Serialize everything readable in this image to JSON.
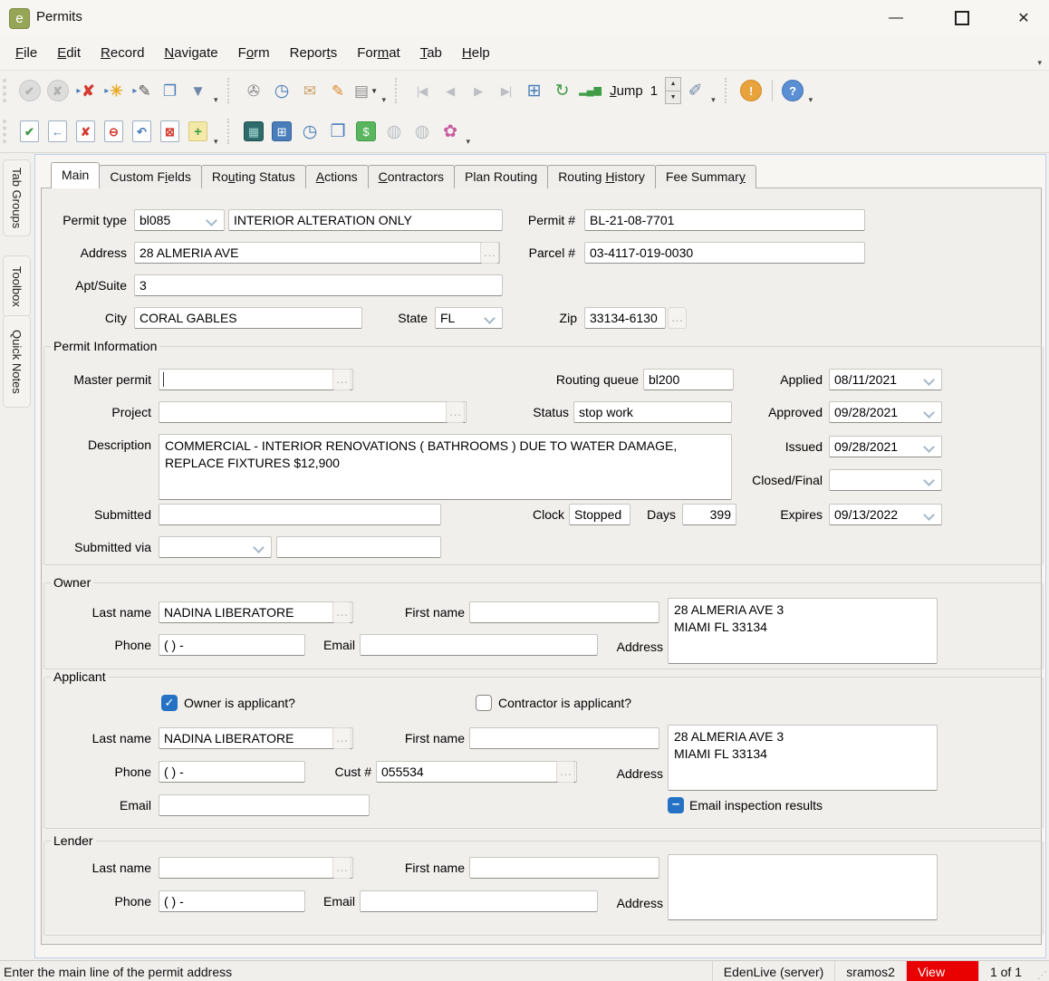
{
  "window": {
    "title": "Permits",
    "app_icon_letter": "e"
  },
  "menu": {
    "items": [
      {
        "label": "File",
        "accel": 0
      },
      {
        "label": "Edit",
        "accel": 0
      },
      {
        "label": "Record",
        "accel": 0
      },
      {
        "label": "Navigate",
        "accel": 0
      },
      {
        "label": "Form",
        "accel": 1
      },
      {
        "label": "Reports",
        "accel": 5
      },
      {
        "label": "Format",
        "accel": 3
      },
      {
        "label": "Tab",
        "accel": 0
      },
      {
        "label": "Help",
        "accel": 0
      }
    ]
  },
  "toolbar1": {
    "items": [
      {
        "name": "accept-record",
        "icon": "accept-record-icon",
        "glyph": "✔",
        "cls": "i-circle c-disabled",
        "disabled": true
      },
      {
        "name": "cancel-record",
        "icon": "cancel-record-icon",
        "glyph": "✘",
        "cls": "i-circle c-disabled",
        "disabled": true
      },
      {
        "name": "delete-record",
        "icon": "delete-record-icon",
        "glyph": "✘",
        "cls": "g-red",
        "pre": "▸"
      },
      {
        "name": "new-record",
        "icon": "new-record-icon",
        "glyph": "✳",
        "cls": "g-gold",
        "pre": "▸"
      },
      {
        "name": "edit-record",
        "icon": "edit-record-icon",
        "glyph": "✎",
        "cls": "g-ink",
        "pre": "▸"
      },
      {
        "name": "copy-record",
        "icon": "copy-record-icon",
        "glyph": "❐",
        "cls": "g-blue"
      },
      {
        "name": "filter",
        "icon": "filter-funnel-icon",
        "glyph": "▼",
        "cls": "g-steel"
      },
      {
        "type": "overflow",
        "name": "toolbar1-group1-overflow"
      },
      {
        "sep": true
      },
      {
        "name": "attachments",
        "icon": "paperclip-icon",
        "glyph": "✇",
        "cls": "g-gray"
      },
      {
        "name": "history",
        "icon": "clock-arrow-icon",
        "glyph": "◷",
        "cls": "g-blue big"
      },
      {
        "name": "send-email",
        "icon": "envelope-icon",
        "glyph": "✉",
        "cls": "g-tan"
      },
      {
        "name": "edit-tag",
        "icon": "tag-pencil-icon",
        "glyph": "✎",
        "cls": "g-orange"
      },
      {
        "name": "print",
        "icon": "printer-icon",
        "glyph": "▤",
        "cls": "g-gray",
        "dd": true
      },
      {
        "type": "overflow",
        "name": "toolbar1-group2-overflow"
      },
      {
        "sep": true
      },
      {
        "name": "first-record",
        "icon": "first-record-icon",
        "glyph": "|◀",
        "cls": "g-disabled nav",
        "disabled": true
      },
      {
        "name": "prev-record",
        "icon": "prev-record-icon",
        "glyph": "◀",
        "cls": "g-disabled nav",
        "disabled": true
      },
      {
        "name": "next-record",
        "icon": "next-record-icon",
        "glyph": "▶",
        "cls": "g-disabled nav",
        "disabled": true
      },
      {
        "name": "last-record",
        "icon": "last-record-icon",
        "glyph": "▶|",
        "cls": "g-disabled nav",
        "disabled": true
      },
      {
        "name": "table-view",
        "icon": "grid-icon",
        "glyph": "⊞",
        "cls": "g-blue big"
      },
      {
        "name": "refresh",
        "icon": "refresh-icon",
        "glyph": "↻",
        "cls": "g-green big"
      },
      {
        "name": "sort-chart",
        "icon": "bar-chart-icon",
        "glyph": "▂▄▆",
        "cls": "g-green bars"
      },
      {
        "type": "label",
        "text": "Jump",
        "accel": 0,
        "name": "jump-label"
      },
      {
        "type": "value",
        "text": "1",
        "name": "jump-value"
      },
      {
        "type": "spinner",
        "name": "jump-spinner"
      },
      {
        "name": "highlighter",
        "icon": "eraser-icon",
        "glyph": "✐",
        "cls": "g-steel big"
      },
      {
        "type": "overflow",
        "name": "toolbar1-group3-overflow"
      },
      {
        "sep": true
      },
      {
        "name": "alerts",
        "icon": "alert-icon",
        "glyph": "!",
        "cls": "i-circle c-orange"
      },
      {
        "divider": true
      },
      {
        "name": "help",
        "icon": "help-icon",
        "glyph": "?",
        "cls": "i-circle c-blue"
      },
      {
        "type": "overflow",
        "name": "toolbar1-help-overflow"
      }
    ]
  },
  "toolbar2": {
    "items": [
      {
        "name": "post-record",
        "icon": "doc-check-icon",
        "glyph": "✔",
        "cls": "i-doc g-green"
      },
      {
        "name": "return-record",
        "icon": "doc-back-arrow-icon",
        "glyph": "←",
        "cls": "i-doc g-blue"
      },
      {
        "name": "reject-record",
        "icon": "doc-x-icon",
        "glyph": "✘",
        "cls": "i-doc g-red"
      },
      {
        "name": "stop-record",
        "icon": "doc-minus-icon",
        "glyph": "⊖",
        "cls": "i-doc g-red"
      },
      {
        "name": "undo-record",
        "icon": "doc-undo-icon",
        "glyph": "↶",
        "cls": "i-doc g-blue"
      },
      {
        "name": "void-record",
        "icon": "doc-delete-icon",
        "glyph": "⊠",
        "cls": "i-doc g-red"
      },
      {
        "name": "add-note",
        "icon": "note-plus-icon",
        "glyph": "+",
        "cls": "i-note"
      },
      {
        "type": "overflow",
        "name": "toolbar2-group1-overflow"
      },
      {
        "sep": true
      },
      {
        "name": "map",
        "icon": "map-icon",
        "glyph": "▦",
        "cls": "i-tile t-teal"
      },
      {
        "name": "calculator",
        "icon": "calculator-icon",
        "glyph": "⊞",
        "cls": "i-tile t-blue"
      },
      {
        "name": "time",
        "icon": "clock-icon",
        "glyph": "◷",
        "cls": "g-blue big"
      },
      {
        "name": "copy-permit",
        "icon": "copy-flag-icon",
        "glyph": "❐",
        "cls": "g-blue big"
      },
      {
        "name": "fees",
        "icon": "cash-icon",
        "glyph": "$",
        "cls": "i-tile t-green"
      },
      {
        "name": "web-one",
        "icon": "globe1-icon",
        "glyph": "◍",
        "cls": "g-disabled big",
        "disabled": true
      },
      {
        "name": "web-two",
        "icon": "globe2-icon",
        "glyph": "◍",
        "cls": "g-disabled big",
        "disabled": true
      },
      {
        "name": "person-search",
        "icon": "person-search-icon",
        "glyph": "✿",
        "cls": "g-pink big"
      },
      {
        "type": "overflow",
        "name": "toolbar2-right-overflow"
      }
    ]
  },
  "sidebar": {
    "tabs": [
      {
        "label": "Tab Groups"
      },
      {
        "label": "Toolbox"
      },
      {
        "label": "Quick Notes"
      }
    ]
  },
  "tabs": {
    "items": [
      {
        "label": "Main",
        "accel": -1,
        "active": true
      },
      {
        "label": "Custom Fields",
        "accel": 8
      },
      {
        "label": "Routing Status",
        "accel": 2
      },
      {
        "label": "Actions",
        "accel": 0
      },
      {
        "label": "Contractors",
        "accel": 0
      },
      {
        "label": "Plan Routing",
        "accel": -1
      },
      {
        "label": "Routing History",
        "accel": 8
      },
      {
        "label": "Fee Summary",
        "accel": 10
      }
    ]
  },
  "form": {
    "permit_type": {
      "label": "Permit type",
      "code": "bl085",
      "description": "INTERIOR ALTERATION ONLY"
    },
    "permit_number": {
      "label": "Permit #",
      "value": "BL-21-08-7701"
    },
    "address": {
      "label": "Address",
      "value": "28 ALMERIA AVE"
    },
    "parcel_number": {
      "label": "Parcel #",
      "value": "03-4117-019-0030"
    },
    "apt_suite": {
      "label": "Apt/Suite",
      "value": "3"
    },
    "city": {
      "label": "City",
      "value": "CORAL GABLES"
    },
    "state": {
      "label": "State",
      "value": "FL"
    },
    "zip": {
      "label": "Zip",
      "value": "33134-6130"
    },
    "permit_information": {
      "title": "Permit Information",
      "master_permit": {
        "label": "Master permit",
        "value": ""
      },
      "project": {
        "label": "Project",
        "value": ""
      },
      "description": {
        "label": "Description",
        "value": "COMMERCIAL - INTERIOR RENOVATIONS ( BATHROOMS ) DUE TO WATER DAMAGE, REPLACE FIXTURES $12,900"
      },
      "submitted": {
        "label": "Submitted",
        "value": ""
      },
      "submitted_via": {
        "label": "Submitted via",
        "value": "",
        "value2": ""
      },
      "routing_queue": {
        "label": "Routing queue",
        "value": "bl200"
      },
      "status": {
        "label": "Status",
        "value": "stop work"
      },
      "clock": {
        "label": "Clock",
        "value": "Stopped"
      },
      "days": {
        "label": "Days",
        "value": "399"
      },
      "applied": {
        "label": "Applied",
        "value": "08/11/2021"
      },
      "approved": {
        "label": "Approved",
        "value": "09/28/2021"
      },
      "issued": {
        "label": "Issued",
        "value": "09/28/2021"
      },
      "closed_final": {
        "label": "Closed/Final",
        "value": ""
      },
      "expires": {
        "label": "Expires",
        "value": "09/13/2022"
      }
    },
    "owner": {
      "title": "Owner",
      "last_name_label": "Last name",
      "last_name": "NADINA LIBERATORE",
      "first_name_label": "First name",
      "first_name": "",
      "phone_label": "Phone",
      "phone": "( )   -",
      "email_label": "Email",
      "email": "",
      "address_label": "Address",
      "address": "28 ALMERIA AVE 3\nMIAMI  FL 33134"
    },
    "applicant": {
      "title": "Applicant",
      "owner_is_applicant_label": "Owner is applicant?",
      "owner_is_applicant_state": "checked",
      "contractor_is_applicant_label": "Contractor is applicant?",
      "contractor_is_applicant_state": "unchecked",
      "last_name_label": "Last name",
      "last_name": "NADINA LIBERATORE",
      "first_name_label": "First name",
      "first_name": "",
      "phone_label": "Phone",
      "phone": "( )   -",
      "cust_number_label": "Cust #",
      "cust_number": "055534",
      "email_label": "Email",
      "email": "",
      "address_label": "Address",
      "address": "28 ALMERIA AVE 3\nMIAMI  FL 33134",
      "email_inspection_label": "Email inspection results",
      "email_inspection_state": "mixed"
    },
    "lender": {
      "title": "Lender",
      "last_name_label": "Last name",
      "last_name": "",
      "first_name_label": "First name",
      "first_name": "",
      "phone_label": "Phone",
      "phone": "( )   -",
      "email_label": "Email",
      "email": "",
      "address_label": "Address",
      "address": ""
    }
  },
  "status_bar": {
    "message": "Enter the main line of the permit address",
    "server": "EdenLive (server)",
    "user": "sramos2",
    "mode": "View",
    "mode_color": "#e90000",
    "record_count": "1 of 1"
  }
}
